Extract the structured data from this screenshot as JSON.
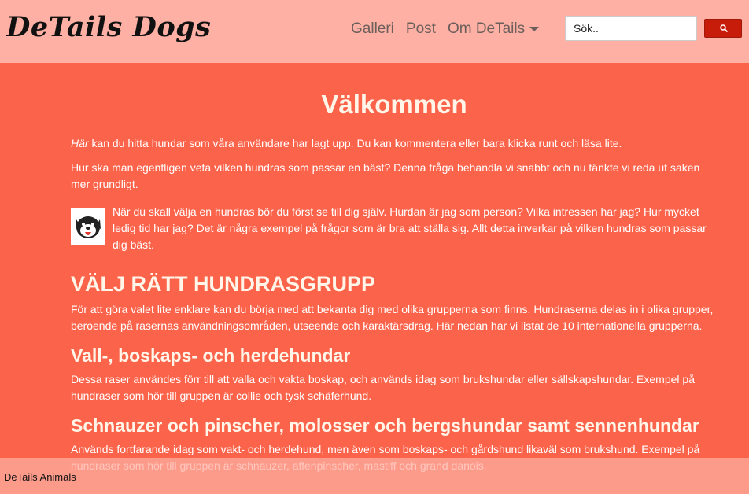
{
  "header": {
    "logo": "DeTails Dogs",
    "nav": {
      "galleri": "Galleri",
      "post": "Post",
      "om": "Om DeTails"
    },
    "search": {
      "placeholder": "Sök.."
    }
  },
  "main": {
    "title": "Välkommen",
    "intro_em": "Här",
    "intro_rest": " kan du hitta hundar som våra användare har lagt upp. Du kan kommentera eller bara klicka runt och läsa lite.",
    "para2": "Hur ska man egentligen veta vilken hundras som passar en bäst? Denna fråga behandla vi snabbt och nu tänkte vi reda ut saken mer grundligt.",
    "para3": "När du skall välja en hundras bör du först se till dig själv. Hurdan är jag som person? Vilka intressen har jag? Hur mycket ledig tid har jag? Det är några exempel på frågor som är bra att ställa sig. Allt detta inverkar på vilken hundras som passar dig bäst.",
    "heading_group": "VÄLJ RÄTT HUNDRASGRUPP",
    "para4": "För att göra valet lite enklare kan du börja med att bekanta dig med olika grupperna som finns. Hundraserna delas in i olika grupper, beroende på rasernas användningsområden, utseende och karaktärsdrag. Här nedan har vi listat de 10 internationella grupperna.",
    "section1": {
      "title": "Vall-, boskaps- och herdehundar",
      "text": "Dessa raser användes förr till att valla och vakta boskap, och används idag som brukshundar eller sällskapshundar. Exempel på hundraser som hör till gruppen är collie och tysk schäferhund."
    },
    "section2": {
      "title": "Schnauzer och pinscher, molosser och bergshundar samt sennenhundar",
      "text": "Används fortfarande idag som vakt- och herdehund, men även som boskaps- och gårdshund likaväl som brukshund. Exempel på hundraser som hör till gruppen är schnauzer, affenpinscher, mastiff och grand danois."
    }
  },
  "footer": {
    "label": "DeTails Animals"
  },
  "icons": {
    "search": "search-icon",
    "dropdown": "caret-down-icon",
    "dog": "dog-face-icon"
  },
  "colors": {
    "page_bg": "#fb644b",
    "navbar_bg": "#fdb0a3",
    "search_button": "#c81c0a"
  }
}
